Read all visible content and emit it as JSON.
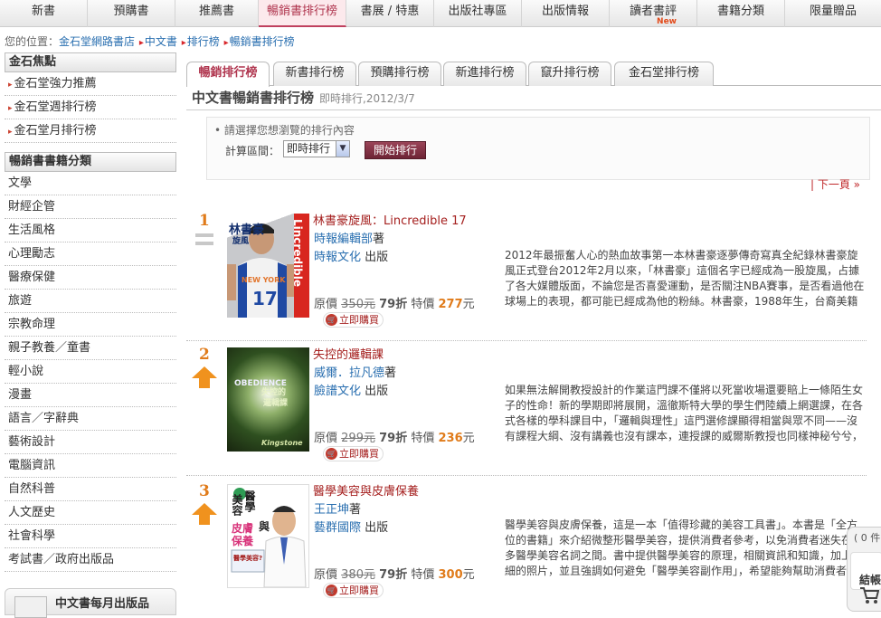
{
  "top_nav": [
    {
      "label": "新書"
    },
    {
      "label": "預購書"
    },
    {
      "label": "推薦書"
    },
    {
      "label": "暢銷書排行榜"
    },
    {
      "label": "書展 / 特惠"
    },
    {
      "label": "出版社專區"
    },
    {
      "label": "出版情報"
    },
    {
      "label": "讀者書評",
      "badge": "New"
    },
    {
      "label": "書籍分類"
    },
    {
      "label": "限量贈品"
    }
  ],
  "breadcrumb": {
    "prefix": "您的位置：",
    "items": [
      "金石堂網路書店",
      "中文書",
      "排行榜",
      "暢銷書排行榜"
    ]
  },
  "sidebar": {
    "featured_title": "金石焦點",
    "featured": [
      "金石堂強力推薦",
      "金石堂週排行榜",
      "金石堂月排行榜"
    ],
    "categories_title": "暢銷書書籍分類",
    "categories": [
      "文學",
      "財經企管",
      "生活風格",
      "心理勵志",
      "醫療保健",
      "旅遊",
      "宗教命理",
      "親子教養／童書",
      "輕小說",
      "漫畫",
      "語言／字辭典",
      "藝術設計",
      "電腦資訊",
      "自然科普",
      "人文歷史",
      "社會科學",
      "考試書／政府出版品"
    ],
    "monthly_title": "中文書每月出版品"
  },
  "tabs": [
    "暢銷排行榜",
    "新書排行榜",
    "預購排行榜",
    "新進排行榜",
    "竄升排行榜",
    "金石堂排行榜"
  ],
  "page_title": "中文書暢銷書排行榜",
  "page_subtitle": "即時排行,2012/3/7",
  "filter": {
    "hint": "請選擇您想瀏覽的排行內容",
    "range_label": "計算區間：",
    "range_value": "即時排行",
    "submit_label": "開始排行"
  },
  "next_page": "| 下一頁 »",
  "books": [
    {
      "rank": "1",
      "trend": "same",
      "title": "林書豪旋風：Lincredible 17",
      "author": "時報編輯部",
      "author_suffix": "著",
      "publisher": "時報文化",
      "publisher_suffix": "出版",
      "original_label": "原價",
      "original_price": "350元",
      "discount": "79折",
      "special_label": "特價",
      "special_price": "277",
      "currency": "元",
      "buy_label": "立即購買",
      "cover_texts": [
        "林書豪",
        "旋風",
        "Lincredible",
        "NEW YORK",
        "17"
      ],
      "description": "2012年最振奮人心的熱血故事第一本林書豪逐夢傳奇寫真全紀錄林書豪旋風正式登台2012年2月以來，「林書豪」這個名字已經成為一股旋風，占據了各大媒體版面，不論您是否喜愛運動，是否關注NBA賽事，是否看過他在球場上的表現，都可能已經成為他的粉絲。林書豪，1988年生，台裔美籍"
    },
    {
      "rank": "2",
      "trend": "up",
      "title": "失控的邏輯課",
      "author": "威爾．拉凡德",
      "author_suffix": "著",
      "publisher": "臉譜文化",
      "publisher_suffix": "出版",
      "original_label": "原價",
      "original_price": "299元",
      "discount": "79折",
      "special_label": "特價",
      "special_price": "236",
      "currency": "元",
      "buy_label": "立即購買",
      "cover_texts": [
        "OBEDIENCE",
        "失控的",
        "邏輯課",
        "Kingstone"
      ],
      "description": "如果無法解開教授設計的作業這門課不僅將以死當收場還要賠上一條陌生女子的性命！新的學期即將展開，溫徹斯特大學的學生們陸續上網選課，在各式各樣的學科課目中，「邏輯與理性」這門選修課顯得相當與眾不同——沒有課程大綱、沒有講義也沒有課本，連授課的威爾斯教授也同樣神秘兮兮，"
    },
    {
      "rank": "3",
      "trend": "up",
      "title": "醫學美容與皮膚保養",
      "author": "王正坤",
      "author_suffix": "著",
      "publisher": "藝群國際",
      "publisher_suffix": "出版",
      "original_label": "原價",
      "original_price": "380元",
      "discount": "79折",
      "special_label": "特價",
      "special_price": "300",
      "currency": "元",
      "buy_label": "立即購買",
      "cover_texts": [
        "醫學",
        "美容",
        "與",
        "皮膚",
        "保養",
        "醫學美容?"
      ],
      "description": "醫學美容與皮膚保養，這是一本「值得珍藏的美容工具書」。本書是「全方位的書籍」來介紹微整形醫學美容，提供消費者參考，以免消費者迷失在眾多醫學美容名詞之間。書中提供醫學美容的原理，相關資訊和知識，加上詳細的照片，並且強調如何避免「醫學美容副作用」，希望能夠幫助消費者"
    }
  ],
  "cart": {
    "count": "( 0 件",
    "checkout": "結帳"
  },
  "colors": {
    "accent": "#b0364f",
    "link": "#2a6fb0",
    "price": "#e07b1a",
    "title": "#a5201f"
  }
}
